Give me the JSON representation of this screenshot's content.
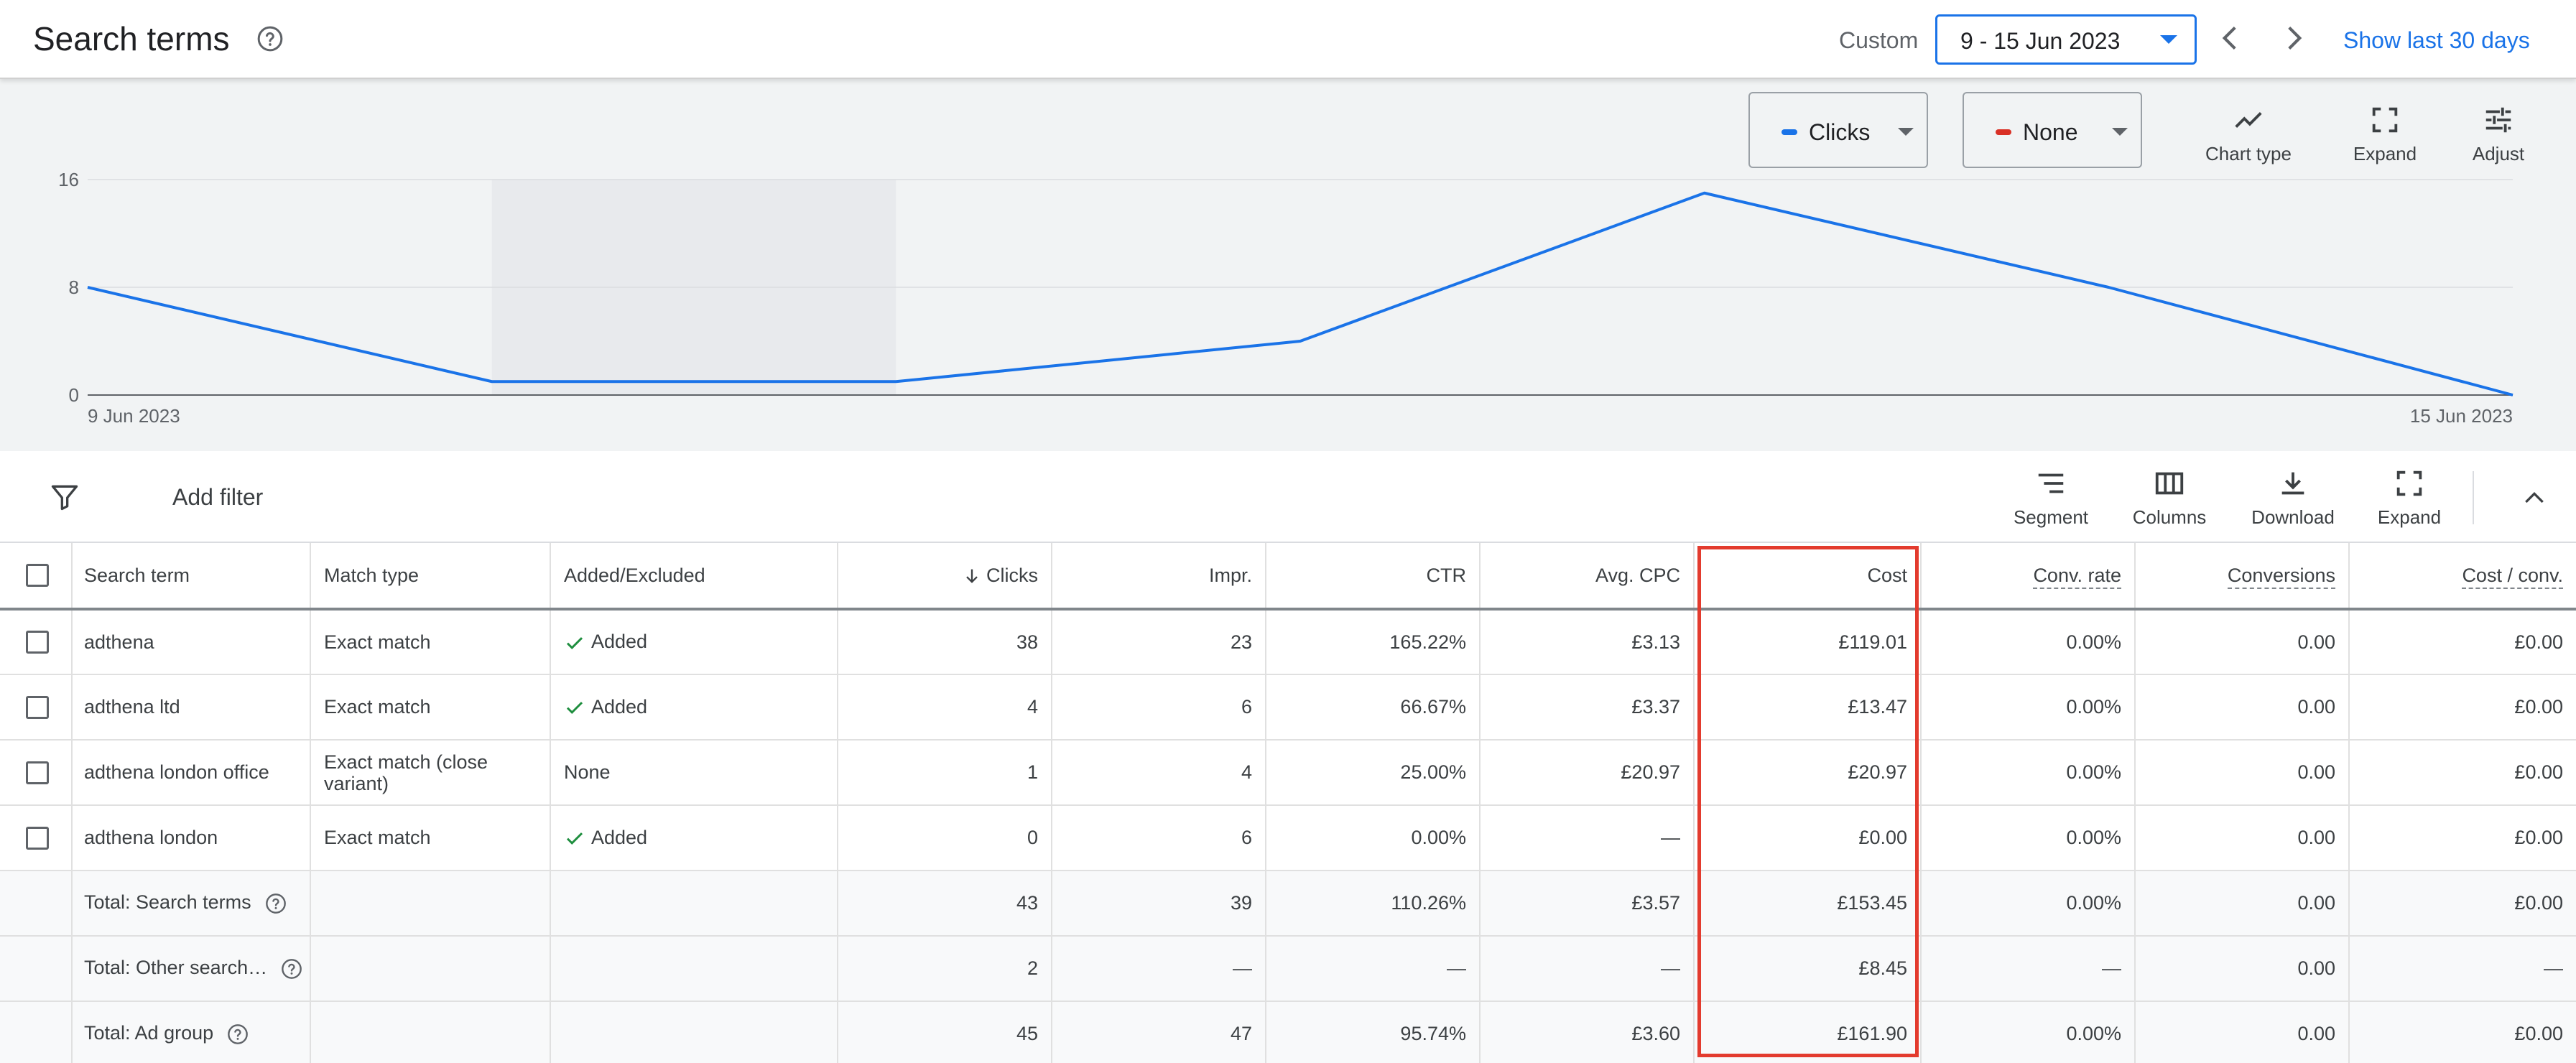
{
  "header": {
    "title": "Search terms",
    "range_label": "Custom",
    "date_range": "9 - 15 Jun 2023",
    "show_last": "Show last 30 days"
  },
  "chart_controls": {
    "metric1": {
      "label": "Clicks",
      "color": "#1a73e8"
    },
    "metric2": {
      "label": "None",
      "color": "#d93025"
    },
    "chart_type": "Chart type",
    "expand": "Expand",
    "adjust": "Adjust"
  },
  "chart_data": {
    "type": "line",
    "x": [
      "9 Jun 2023",
      "10 Jun 2023",
      "11 Jun 2023",
      "12 Jun 2023",
      "13 Jun 2023",
      "14 Jun 2023",
      "15 Jun 2023"
    ],
    "series": [
      {
        "name": "Clicks",
        "values": [
          8,
          1,
          1,
          4,
          15,
          8,
          0
        ]
      }
    ],
    "y_ticks": [
      "0",
      "8",
      "16"
    ],
    "ylim": [
      0,
      16
    ],
    "x_tick_labels": [
      "9 Jun 2023",
      "15 Jun 2023"
    ],
    "grid": true,
    "highlight_range": [
      "10 Jun 2023",
      "11 Jun 2023"
    ]
  },
  "toolbar": {
    "add_filter": "Add filter",
    "segment": "Segment",
    "columns": "Columns",
    "download": "Download",
    "expand": "Expand"
  },
  "table": {
    "columns": [
      "Search term",
      "Match type",
      "Added/Excluded",
      "Clicks",
      "Impr.",
      "CTR",
      "Avg. CPC",
      "Cost",
      "Conv. rate",
      "Conversions",
      "Cost / conv."
    ],
    "rows": [
      {
        "term": "adthena",
        "match": "Exact match",
        "added": "Added",
        "clicks": "38",
        "impr": "23",
        "ctr": "165.22%",
        "cpc": "£3.13",
        "cost": "£119.01",
        "conv_rate": "0.00%",
        "conversions": "0.00",
        "cost_conv": "£0.00"
      },
      {
        "term": "adthena ltd",
        "match": "Exact match",
        "added": "Added",
        "clicks": "4",
        "impr": "6",
        "ctr": "66.67%",
        "cpc": "£3.37",
        "cost": "£13.47",
        "conv_rate": "0.00%",
        "conversions": "0.00",
        "cost_conv": "£0.00"
      },
      {
        "term": "adthena london office",
        "match": "Exact match (close variant)",
        "added": "None",
        "clicks": "1",
        "impr": "4",
        "ctr": "25.00%",
        "cpc": "£20.97",
        "cost": "£20.97",
        "conv_rate": "0.00%",
        "conversions": "0.00",
        "cost_conv": "£0.00"
      },
      {
        "term": "adthena london",
        "match": "Exact match",
        "added": "Added",
        "clicks": "0",
        "impr": "6",
        "ctr": "0.00%",
        "cpc": "—",
        "cost": "£0.00",
        "conv_rate": "0.00%",
        "conversions": "0.00",
        "cost_conv": "£0.00"
      }
    ],
    "totals": [
      {
        "label": "Total: Search terms",
        "clicks": "43",
        "impr": "39",
        "ctr": "110.26%",
        "cpc": "£3.57",
        "cost": "£153.45",
        "conv_rate": "0.00%",
        "conversions": "0.00",
        "cost_conv": "£0.00"
      },
      {
        "label": "Total: Other search…",
        "clicks": "2",
        "impr": "—",
        "ctr": "—",
        "cpc": "—",
        "cost": "£8.45",
        "conv_rate": "—",
        "conversions": "0.00",
        "cost_conv": "—"
      },
      {
        "label": "Total: Ad group",
        "clicks": "45",
        "impr": "47",
        "ctr": "95.74%",
        "cpc": "£3.60",
        "cost": "£161.90",
        "conv_rate": "0.00%",
        "conversions": "0.00",
        "cost_conv": "£0.00"
      }
    ]
  },
  "colors": {
    "accent": "#1a73e8",
    "added_check": "#1e8e3e",
    "highlight_box": "#e33b2e"
  }
}
